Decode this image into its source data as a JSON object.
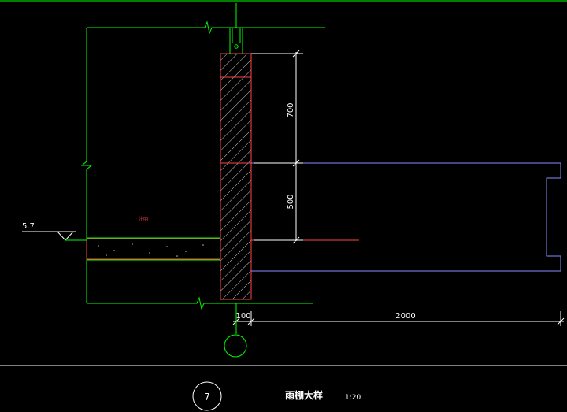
{
  "drawing": {
    "dims": {
      "vertical_upper": "700",
      "vertical_lower": "500",
      "horizontal_wall": "100",
      "horizontal_canopy": "2000"
    },
    "elevation": "5.7",
    "axis_label": "",
    "detail": {
      "number": "7",
      "title": "雨棚大样",
      "scale": "1:20"
    },
    "room_note": "注明"
  },
  "colors": {
    "background": "#000000",
    "outline": "#00ff00",
    "structure": "#ff4444",
    "canopy": "#8a8aff",
    "dimension": "#ffffff",
    "axis": "#00ff00"
  }
}
